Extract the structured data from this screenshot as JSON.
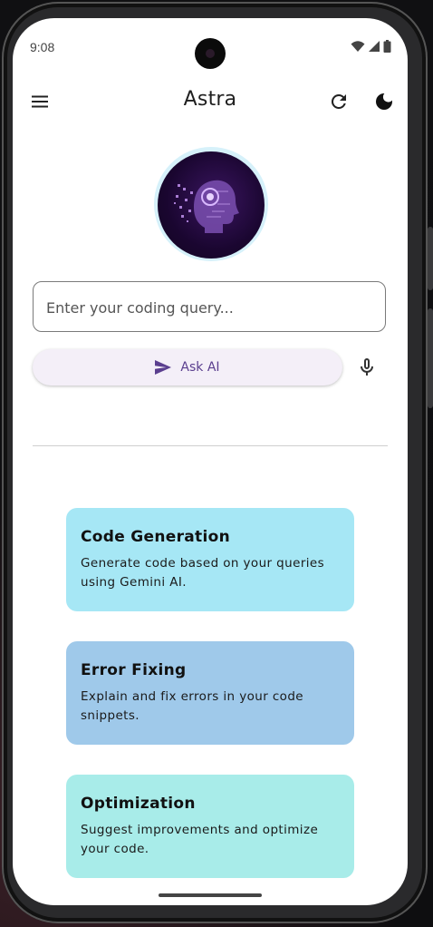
{
  "status_bar": {
    "time": "9:08",
    "icons": [
      "wifi-icon",
      "signal-icon",
      "battery-icon"
    ]
  },
  "app_bar": {
    "title": "Astra",
    "menu_icon": "menu-icon",
    "refresh_icon": "refresh-icon",
    "theme_icon": "dark-mode-icon"
  },
  "query": {
    "placeholder": "Enter your coding query...",
    "value": ""
  },
  "ask_button": {
    "label": "Ask AI",
    "icon": "send-icon"
  },
  "mic": {
    "icon": "mic-icon"
  },
  "cards": [
    {
      "title": "Code Generation",
      "description": "Generate code based on your queries using Gemini AI.",
      "color": "#a6e7f5"
    },
    {
      "title": "Error Fixing",
      "description": "Explain and fix errors in your code snippets.",
      "color": "#9fc9ea"
    },
    {
      "title": "Optimization",
      "description": "Suggest improvements and optimize your code.",
      "color": "#a8ece9"
    }
  ],
  "colors": {
    "accent": "#5b3f8f",
    "ask_button_bg": "#f4eff8",
    "avatar_ring": "#d6f1fa"
  }
}
